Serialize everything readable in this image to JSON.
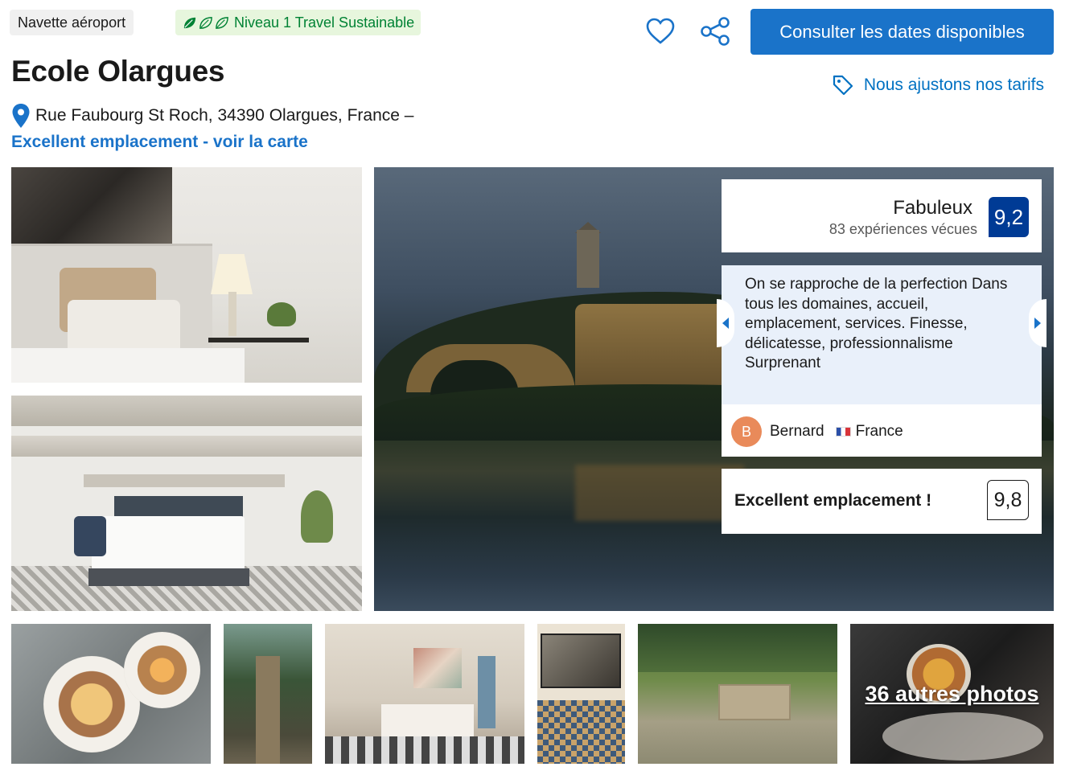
{
  "badges": {
    "shuttle": "Navette aéroport",
    "sustainable": "Niveau 1 Travel Sustainable"
  },
  "actions": {
    "cta_label": "Consulter les dates disponibles",
    "price_match": "Nous ajustons nos tarifs"
  },
  "hotel": {
    "name": "Ecole Olargues",
    "address": "Rue Faubourg St Roch, 34390 Olargues, France –",
    "map_link": "Excellent emplacement - voir la carte"
  },
  "review_summary": {
    "rating_word": "Fabuleux",
    "review_count": "83 expériences vécues",
    "score": "9,2"
  },
  "featured_review": {
    "text": "On se rapproche de la perfection Dans tous les domaines, accueil, emplacement, services. Finesse, délicatesse, professionnalisme Surprenant",
    "reviewer_initial": "B",
    "reviewer_name": "Bernard",
    "reviewer_country": "France"
  },
  "location_rating": {
    "label": "Excellent emplacement !",
    "score": "9,8"
  },
  "gallery": {
    "more_photos": "36 autres photos"
  },
  "colors": {
    "primary_blue": "#1a73c9",
    "score_blue": "#003b95",
    "sustainable_green": "#008234",
    "link_blue": "#0071c2"
  },
  "icons": [
    "leaf-icon",
    "heart-icon",
    "share-icon",
    "tag-icon",
    "map-pin-icon",
    "chevron-left-icon",
    "chevron-right-icon",
    "flag-france-icon"
  ]
}
